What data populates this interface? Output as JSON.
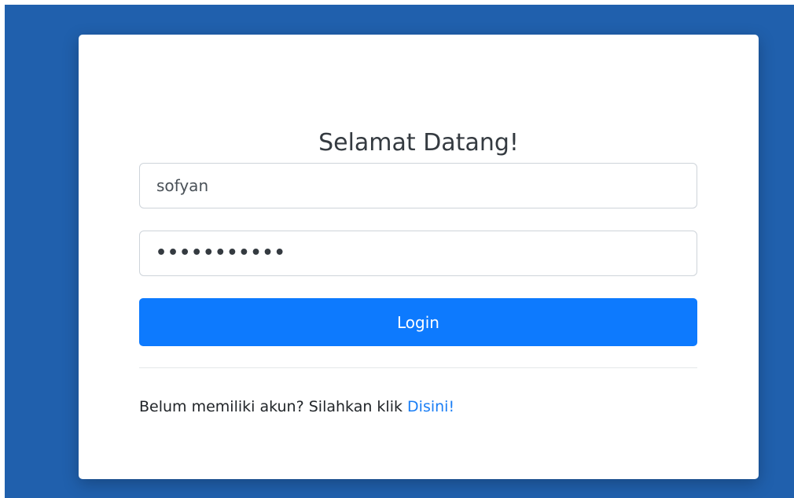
{
  "colors": {
    "backdrop": "#2060ad",
    "card": "#ffffff",
    "primary_button": "#0d7afe",
    "link": "#1a7ef5"
  },
  "login": {
    "title": "Selamat Datang!",
    "username_value": "sofyan",
    "password_mask": "•••••••••••",
    "button_label": "Login",
    "signup_prompt": "Belum memiliki akun? Silahkan klik ",
    "signup_link": "Disini!"
  }
}
